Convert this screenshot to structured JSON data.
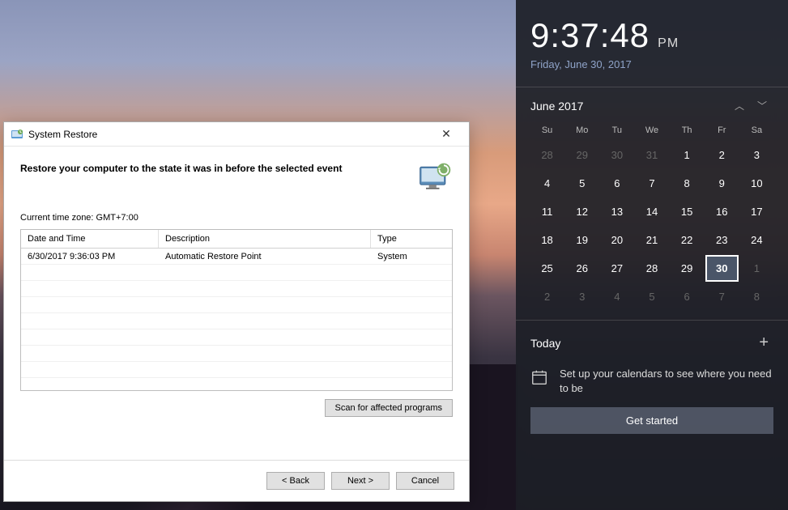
{
  "window": {
    "title": "System Restore",
    "heading": "Restore your computer to the state it was in before the selected event",
    "timezone_label": "Current time zone: GMT+7:00",
    "columns": {
      "datetime": "Date and Time",
      "description": "Description",
      "type": "Type"
    },
    "rows": [
      {
        "datetime": "6/30/2017 9:36:03 PM",
        "description": "Automatic Restore Point",
        "type": "System"
      }
    ],
    "scan_button": "Scan for affected programs",
    "back_button": "< Back",
    "next_button": "Next >",
    "cancel_button": "Cancel"
  },
  "clock": {
    "time": "9:37:48",
    "ampm": "PM",
    "date": "Friday, June 30, 2017"
  },
  "calendar": {
    "month_label": "June 2017",
    "dow": [
      "Su",
      "Mo",
      "Tu",
      "We",
      "Th",
      "Fr",
      "Sa"
    ],
    "days": [
      {
        "n": 28,
        "other": true
      },
      {
        "n": 29,
        "other": true
      },
      {
        "n": 30,
        "other": true
      },
      {
        "n": 31,
        "other": true
      },
      {
        "n": 1
      },
      {
        "n": 2
      },
      {
        "n": 3
      },
      {
        "n": 4
      },
      {
        "n": 5
      },
      {
        "n": 6
      },
      {
        "n": 7
      },
      {
        "n": 8
      },
      {
        "n": 9
      },
      {
        "n": 10
      },
      {
        "n": 11
      },
      {
        "n": 12
      },
      {
        "n": 13
      },
      {
        "n": 14
      },
      {
        "n": 15
      },
      {
        "n": 16
      },
      {
        "n": 17
      },
      {
        "n": 18
      },
      {
        "n": 19
      },
      {
        "n": 20
      },
      {
        "n": 21
      },
      {
        "n": 22
      },
      {
        "n": 23
      },
      {
        "n": 24
      },
      {
        "n": 25
      },
      {
        "n": 26
      },
      {
        "n": 27
      },
      {
        "n": 28
      },
      {
        "n": 29
      },
      {
        "n": 30,
        "today": true
      },
      {
        "n": 1,
        "other": true
      },
      {
        "n": 2,
        "other": true
      },
      {
        "n": 3,
        "other": true
      },
      {
        "n": 4,
        "other": true
      },
      {
        "n": 5,
        "other": true
      },
      {
        "n": 6,
        "other": true
      },
      {
        "n": 7,
        "other": true
      },
      {
        "n": 8,
        "other": true
      }
    ]
  },
  "agenda": {
    "title": "Today",
    "message": "Set up your calendars to see where you need to be",
    "cta": "Get started"
  }
}
